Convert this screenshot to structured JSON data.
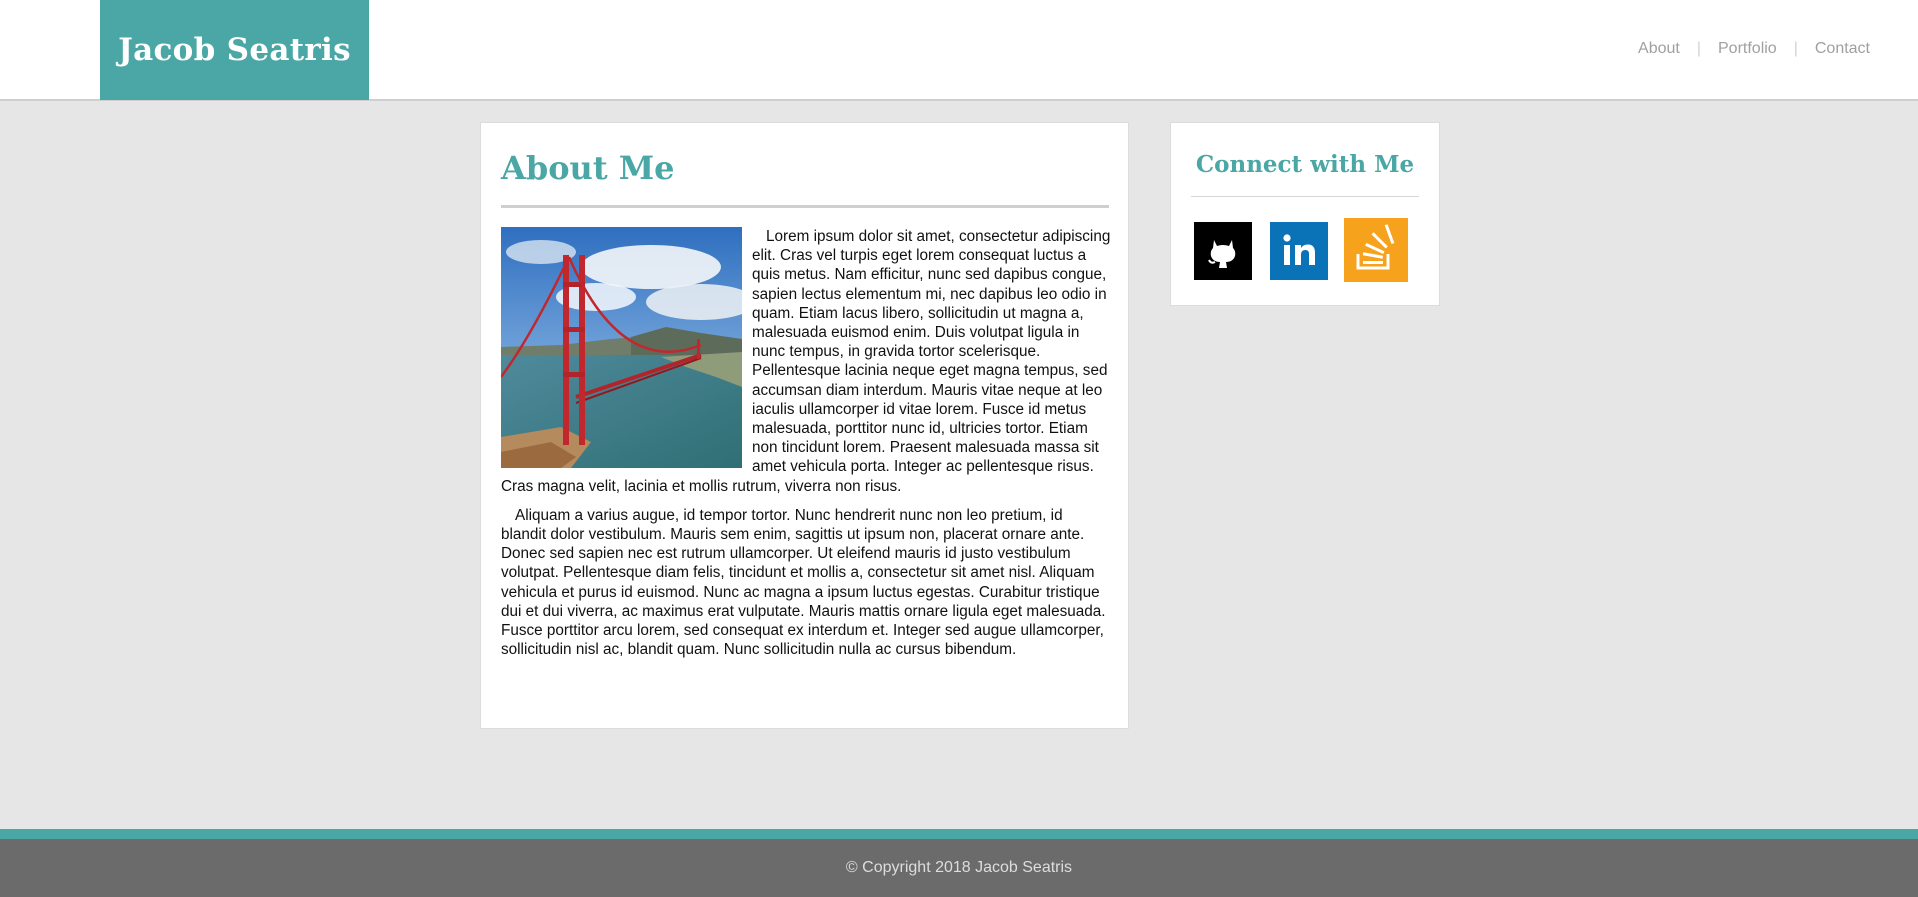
{
  "header": {
    "brand": "Jacob Seatris",
    "nav": [
      {
        "label": "About"
      },
      {
        "label": "Portfolio"
      },
      {
        "label": "Contact"
      }
    ],
    "separator": "|"
  },
  "about": {
    "title": "About Me",
    "image": {
      "alt": "Golden Gate Bridge photo",
      "icon": "golden-gate-bridge-photo"
    },
    "paragraphs": [
      "Lorem ipsum dolor sit amet, consectetur adipiscing elit. Cras vel turpis eget lorem consequat luctus a quis metus. Nam efficitur, nunc sed dapibus congue, sapien lectus elementum mi, nec dapibus leo odio in quam. Etiam lacus libero, sollicitudin ut magna a, malesuada euismod enim. Duis volutpat ligula in nunc tempus, in gravida tortor scelerisque. Pellentesque lacinia neque eget magna tempus, sed accumsan diam interdum. Mauris vitae neque at leo iaculis ullamcorper id vitae lorem. Fusce id metus malesuada, porttitor nunc id, ultricies tortor. Etiam non tincidunt lorem. Praesent malesuada massa sit amet vehicula porta. Integer ac pellentesque risus. Cras magna velit, lacinia et mollis rutrum, viverra non risus.",
      "Aliquam a varius augue, id tempor tortor. Nunc hendrerit nunc non leo pretium, id blandit dolor vestibulum. Mauris sem enim, sagittis ut ipsum non, placerat ornare ante. Donec sed sapien nec est rutrum ullamcorper. Ut eleifend mauris id justo vestibulum volutpat. Pellentesque diam felis, tincidunt et mollis a, consectetur sit amet nisl. Aliquam vehicula et purus id euismod. Nunc ac magna a ipsum luctus egestas. Curabitur tristique dui et dui viverra, ac maximus erat vulputate. Mauris mattis ornare ligula eget malesuada. Fusce porttitor arcu lorem, sed consequat ex interdum et. Integer sed augue ullamcorper, sollicitudin nisl ac, blandit quam. Nunc sollicitudin nulla ac cursus bibendum."
    ]
  },
  "connect": {
    "title": "Connect with Me",
    "links": [
      {
        "icon": "github-icon",
        "color": "#000000"
      },
      {
        "icon": "linkedin-icon",
        "color": "#0a73b7"
      },
      {
        "icon": "stackoverflow-icon",
        "color": "#f7a21d"
      }
    ]
  },
  "footer": {
    "copyright": "© Copyright 2018 Jacob Seatris"
  },
  "colors": {
    "accent": "#4aa7a6",
    "page_background": "#e6e6e6",
    "footer_background": "#6b6b6b"
  }
}
